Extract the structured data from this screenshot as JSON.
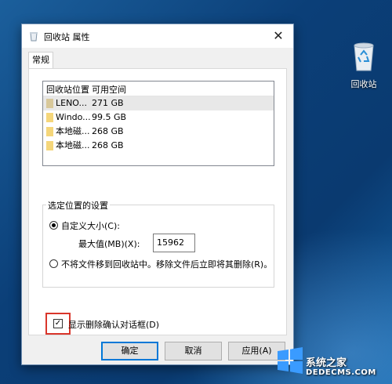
{
  "desktop": {
    "recycle_bin_label": "回收站"
  },
  "dialog": {
    "title": "回收站 属性",
    "close_glyph": "✕",
    "tabs": [
      {
        "label": "常规"
      }
    ],
    "list": {
      "headers": [
        "回收站位置",
        "可用空间"
      ],
      "rows": [
        {
          "name": "LENO...",
          "space": "271 GB",
          "selected": true
        },
        {
          "name": "Windo...",
          "space": "99.5 GB",
          "selected": false
        },
        {
          "name": "本地磁...",
          "space": "268 GB",
          "selected": false
        },
        {
          "name": "本地磁...",
          "space": "268 GB",
          "selected": false
        }
      ]
    },
    "settings": {
      "legend": "选定位置的设置",
      "custom_size_label": "自定义大小(C):",
      "custom_size_selected": true,
      "max_label": "最大值(MB)(X):",
      "max_value": "15962",
      "no_move_label": "不将文件移到回收站中。移除文件后立即将其删除(R)。",
      "no_move_selected": false
    },
    "confirm": {
      "label": "显示删除确认对话框(D)",
      "checked": true,
      "check_glyph": "✓"
    },
    "buttons": {
      "ok": "确定",
      "cancel": "取消",
      "apply": "应用(A)"
    }
  },
  "watermark": {
    "text": "系统之家",
    "site": "DEDECMS.COM"
  },
  "colors": {
    "highlight_box": "#d9362b",
    "primary_button_border": "#0078d7",
    "folder_yellow": "#f5d67a",
    "folder_tan": "#d8c89a"
  }
}
